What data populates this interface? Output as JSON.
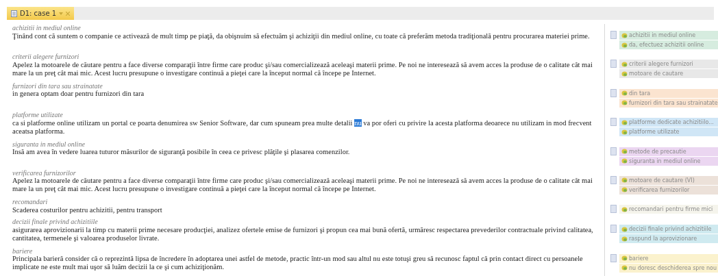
{
  "tab": {
    "label": "D1: case 1",
    "selected": true
  },
  "segments": [
    {
      "heading": "achizitii in mediul online",
      "text": "Ţinând cont că suntem o companie ce activează de mult timp pe piaţă, da obişnuim să efectuăm şi achiziţii din mediul online, cu toate că preferăm metoda tradiţională pentru procurarea materiei prime.",
      "codes": [
        "achizitii in mediul online",
        "da, efectuez achizitii online"
      ],
      "color": "#d6ecdf"
    },
    {
      "heading": "criterii alegere furnizori",
      "text": "Apelez la motoarele de căutare pentru a face diverse comparaţii între firme care produc şi/sau comercializează aceleaşi materii prime. Pe noi ne interesează să avem acces la produse de o calitate cât mai mare la un preţ cât mai mic. Acest lucru presupune o investigare continuă a pieţei care la început normal că începe pe Internet.",
      "codes": [
        "criterii alegere furnizori",
        "motoare de cautare"
      ],
      "color": "#e8e8e8"
    },
    {
      "heading": "furnizori din tara sau strainatate",
      "text": "in genera optam doar pentru furnizori din tara",
      "codes": [
        "din tara",
        "furnizori din tara sau strainatate"
      ],
      "color": "#fbe4d0"
    },
    {
      "heading": "platforme utilizate",
      "text": "ca si platforme online utilizam un portal ce poarta denumirea sw Senior Software, dar cum spuneam prea multe detalii",
      "selection": "nu",
      "text_after": "va por oferi cu privire la acesta platforma deoarece nu utilizam in mod frecvent aceatsa platforma.",
      "codes": [
        "platforme dedicate achizitiilo...",
        "platforme utilizate"
      ],
      "color": "#d0e6f6"
    },
    {
      "heading": "siguranta in mediul online",
      "text": "Insă am avea în vedere luarea tuturor măsurilor de siguranţă posibile în ceea ce privesc plăţile şi plasarea comenzilor.",
      "codes": [
        "metode de precautie",
        "siguranta in mediul online"
      ],
      "color": "#ebd6f1"
    },
    {
      "heading": "verificarea furnizorilor",
      "text": "Apelez la motoarele de căutare pentru a face diverse comparaţii între firme care produc şi/sau comercializează aceleaşi materii prime. Pe noi ne interesează să avem acces la produse de o calitate cât mai mare la un preţ cât mai mic. Acest lucru presupune o investigare continuă a pieţei care la început normal că începe pe Internet.",
      "codes": [
        "motoare de cautare (VI)",
        "verificarea furnizorilor"
      ],
      "color": "#ece1d9"
    },
    {
      "heading": "recomandari",
      "text": "Scaderea costurilor pentru achizitii, pentru transport",
      "codes": [
        "recomandari pentru firme mici"
      ],
      "color": "#f5f4ec"
    },
    {
      "heading": "decizii finale privind achizitiile",
      "text": "asigurarea aprovizionarii la timp cu materii prime necesare producţiei, analizez ofertele emise de furnizori şi propun cea mai bună ofertă, urmăresc respectarea prevederilor contractuale privind calitatea, cantitatea, termenele şi valoarea produselor livrate.",
      "codes": [
        "decizii finale privind achizitiile",
        "raspund la aprovizionare"
      ],
      "color": "#cfeaf0"
    },
    {
      "heading": "bariere",
      "text": "Principala barieră consider că o reprezintă lipsa de încredere în adoptarea unei astfel de metode, practic într-un mod sau altul nu este totuşi greu să recunosc faptul că prin contact direct cu persoanele implicate ne este mult mai uşor să luăm decizii la ce şi cum achiziţionăm.",
      "codes": [
        "bariere",
        "nu doresc deschiderea spre nou"
      ],
      "color": "#fbf2cd"
    }
  ]
}
